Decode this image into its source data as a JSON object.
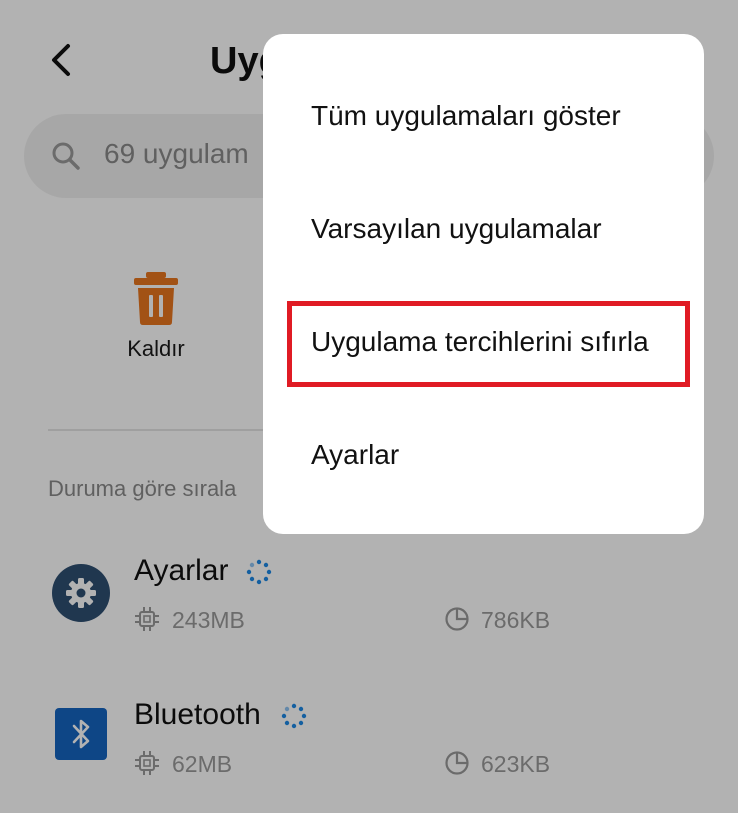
{
  "header": {
    "title": "Uyg",
    "back_icon": "chevron-left-icon"
  },
  "search": {
    "placeholder": "69 uygulam"
  },
  "actions": [
    {
      "label": "Kaldır",
      "icon": "trash-icon",
      "color": "#E8761F"
    }
  ],
  "sort": {
    "label": "Duruma göre sırala"
  },
  "apps": [
    {
      "name": "Ayarlar",
      "ram": "243MB",
      "storage": "786KB",
      "icon": "gear-icon",
      "icon_color": "#2f4f72"
    },
    {
      "name": "Bluetooth",
      "ram": "62MB",
      "storage": "623KB",
      "icon": "bluetooth-icon",
      "icon_color": "#1565c0"
    }
  ],
  "menu": {
    "items": [
      {
        "label": "Tüm uygulamaları göster"
      },
      {
        "label": "Varsayılan uygulamalar"
      },
      {
        "label": "Uygulama tercihlerini sıfırla",
        "highlighted": true
      },
      {
        "label": "Ayarlar"
      }
    ],
    "highlight_color": "#e01b24"
  }
}
